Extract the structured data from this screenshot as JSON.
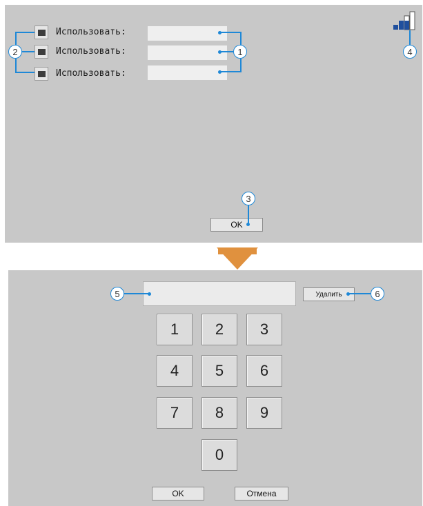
{
  "settings_screen": {
    "rows": [
      {
        "label": "Использовать:",
        "value": ""
      },
      {
        "label": "Использовать:",
        "value": ""
      },
      {
        "label": "Использовать:",
        "value": ""
      }
    ],
    "ok_label": "OK",
    "signal_icon": "signal-strength-icon"
  },
  "keypad_screen": {
    "input_value": "",
    "delete_label": "Удалить",
    "keys": [
      "1",
      "2",
      "3",
      "4",
      "5",
      "6",
      "7",
      "8",
      "9",
      "0"
    ],
    "ok_label": "OK",
    "cancel_label": "Отмена"
  },
  "callouts": [
    "1",
    "2",
    "3",
    "4",
    "5",
    "6"
  ],
  "colors": {
    "callout": "#1e88d7",
    "arrow": "#e0913e",
    "panel": "#c8c8c8"
  }
}
